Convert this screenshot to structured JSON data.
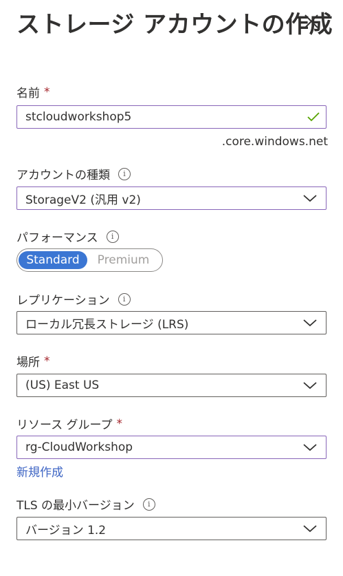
{
  "panel": {
    "title": "ストレージ アカウントの作成"
  },
  "name_field": {
    "label": "名前",
    "required_mark": "*",
    "value": "stcloudworkshop5",
    "suffix": ".core.windows.net"
  },
  "account_kind": {
    "label": "アカウントの種類",
    "info": "i",
    "value": "StorageV2 (汎用 v2)"
  },
  "performance": {
    "label": "パフォーマンス",
    "info": "i",
    "options": [
      "Standard",
      "Premium"
    ],
    "selected": "Standard"
  },
  "replication": {
    "label": "レプリケーション",
    "info": "i",
    "value": "ローカル冗長ストレージ (LRS)"
  },
  "location": {
    "label": "場所",
    "required_mark": "*",
    "value": "(US) East US"
  },
  "resource_group": {
    "label": "リソース グループ",
    "required_mark": "*",
    "value": "rg-CloudWorkshop",
    "create_new_link": "新規作成"
  },
  "tls": {
    "label": "TLS の最小バージョン",
    "info": "i",
    "value": "バージョン 1.2"
  },
  "colors": {
    "accent": "#3b76d3",
    "focus_border": "#8764b8",
    "required": "#a4262c",
    "valid_check": "#57a300",
    "link": "#3f66c4"
  },
  "icons": [
    "close-icon",
    "check-icon",
    "info-icon",
    "chevron-down-icon"
  ]
}
